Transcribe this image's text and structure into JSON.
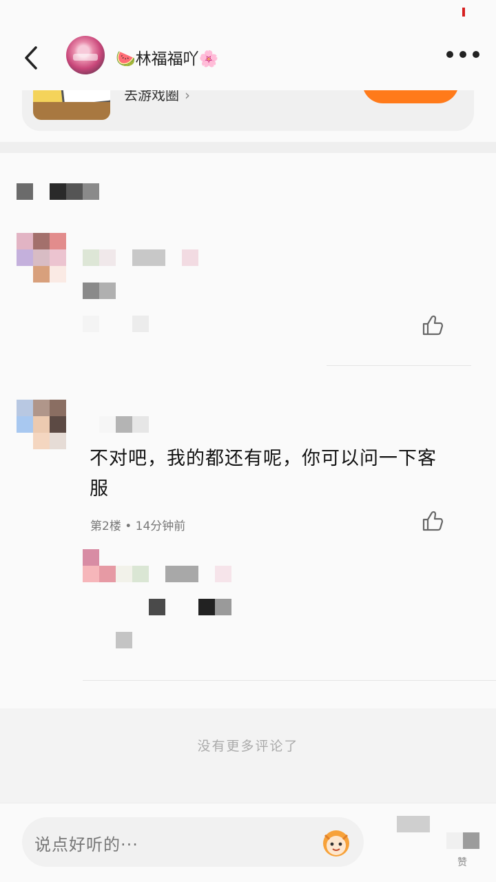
{
  "header": {
    "username": "🍉林福福吖🌸"
  },
  "game_card": {
    "link_label": "去游戏圈",
    "chevron": "›"
  },
  "comments": [
    {
      "text": "",
      "meta": ""
    },
    {
      "text": "不对吧，我的都还有呢，你可以问一下客服",
      "meta": "第2楼 • 14分钟前"
    }
  ],
  "footer": {
    "no_more": "没有更多评论了"
  },
  "input": {
    "placeholder": "说点好听的···"
  },
  "bottom_right_label": "赞",
  "icons": {
    "back": "back-arrow-icon",
    "more": "more-dots-icon",
    "like": "thumbs-up-icon",
    "emoji": "emoji-face-icon"
  },
  "colors": {
    "accent": "#ff7a1a",
    "status_mark": "#d62020"
  }
}
